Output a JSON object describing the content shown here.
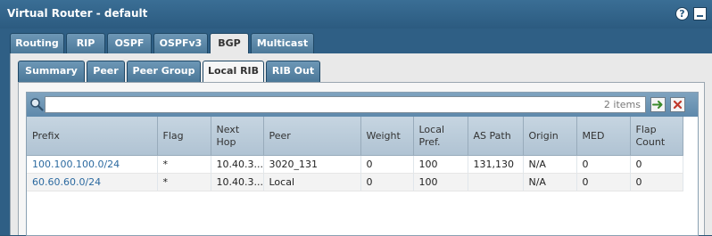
{
  "window": {
    "title": "Virtual Router - default",
    "help_label": "?"
  },
  "tabs": [
    "Routing",
    "RIP",
    "OSPF",
    "OSPFv3",
    "BGP",
    "Multicast"
  ],
  "active_tab": "BGP",
  "subtabs": [
    "Summary",
    "Peer",
    "Peer Group",
    "Local RIB",
    "RIB Out"
  ],
  "active_subtab": "Local RIB",
  "filter": {
    "value": "",
    "count_text": "2 items"
  },
  "table": {
    "columns": [
      "Prefix",
      "Flag",
      "Next Hop",
      "Peer",
      "Weight",
      "Local Pref.",
      "AS Path",
      "Origin",
      "MED",
      "Flap Count"
    ],
    "rows": [
      [
        "100.100.100.0/24",
        "*",
        "10.40.3...",
        "3020_131",
        "0",
        "100",
        "131,130",
        "N/A",
        "0",
        "0"
      ],
      [
        "60.60.60.0/24",
        "*",
        "10.40.3...",
        "Local",
        "0",
        "100",
        "",
        "N/A",
        "0",
        "0"
      ]
    ]
  }
}
